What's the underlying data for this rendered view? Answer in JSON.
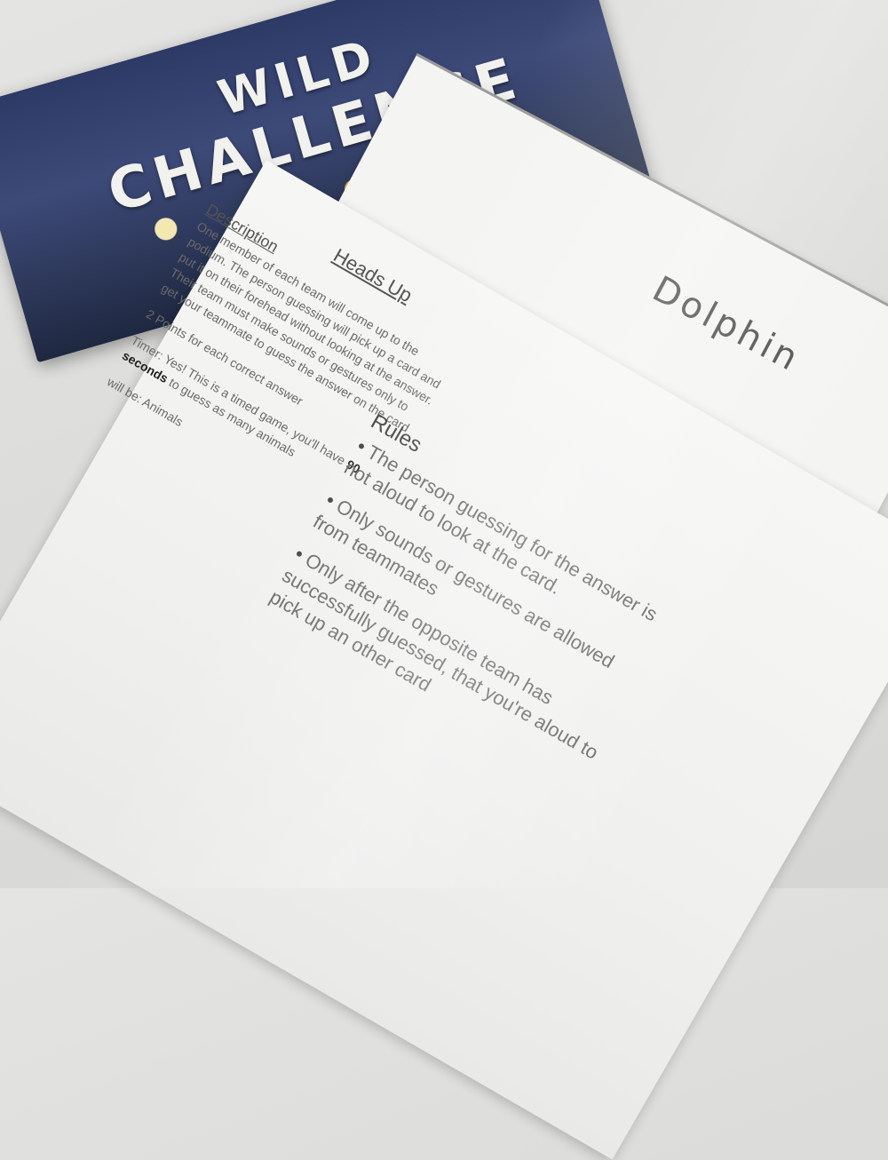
{
  "poster": {
    "title_line1": "WILD",
    "title_line2": "CHALLENGE"
  },
  "dolphin_card": {
    "word": "Dolphin"
  },
  "rules_card": {
    "title": "Heads Up",
    "description_heading": "Description",
    "description_text": "One member of each team will come up to the podium. The person guessing will pick up a card and put it on their forehead without looking at the answer. Their team must make sounds or gestures only to get your teammate to guess the answer on the card",
    "points": "2 Points for each correct answer",
    "timer_prefix": "Timer: Yes! This is a timed game, you'll have",
    "timer_bold": "90 seconds",
    "timer_suffix": "to guess as many animals",
    "topic": "will be: Animals",
    "rules_heading": "Rules",
    "rules": [
      "The person guessing for the answer is not aloud to look at the card.",
      "Only sounds or gestures are allowed from teammates",
      "Only after the opposite team has successfully guessed, that you're aloud to pick up an other card"
    ]
  }
}
